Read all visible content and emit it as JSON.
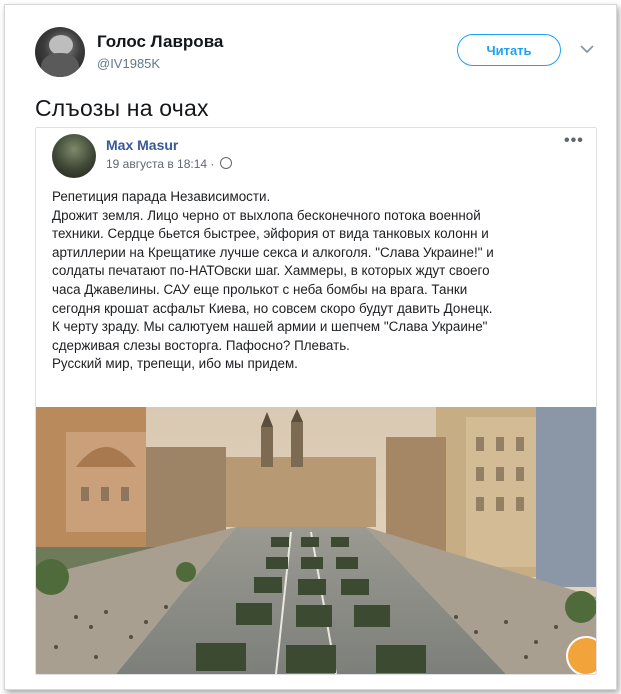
{
  "tweet": {
    "author_name": "Голос Лаврова",
    "author_handle": "@IV1985K",
    "follow_label": "Читать",
    "text": "Слъозы на очах"
  },
  "fb_post": {
    "author_name": "Max Masur",
    "date": "19 августа в 18:14 ·",
    "more_label": "•••",
    "lines": [
      "Репетиция парада Независимости.",
      "Дрожит земля. Лицо черно от выхлопа бесконечного потока военной",
      "техники. Сердце бьется быстрее, эйфория от вида танковых колонн и",
      "артиллерии на Крещатике лучше секса и алкоголя. \"Слава Украине!\" и",
      "солдаты печатают по-НАТОвски шаг. Хаммеры, в которых ждут своего",
      "часа Джавелины. САУ еще пролькот с неба бомбы на врага. Танки",
      "сегодня крошат асфальт Киева, но совсем скоро будут давить Донецк.",
      "К черту зраду. Мы салютуем нашей армии и шепчем \"Слава Украине\"",
      "сдерживая слезы восторга. Пафосно? Плевать.",
      "Русский мир, трепещи, ибо мы придем."
    ]
  },
  "colors": {
    "accent": "#1da1f2",
    "fb_name": "#385898"
  }
}
